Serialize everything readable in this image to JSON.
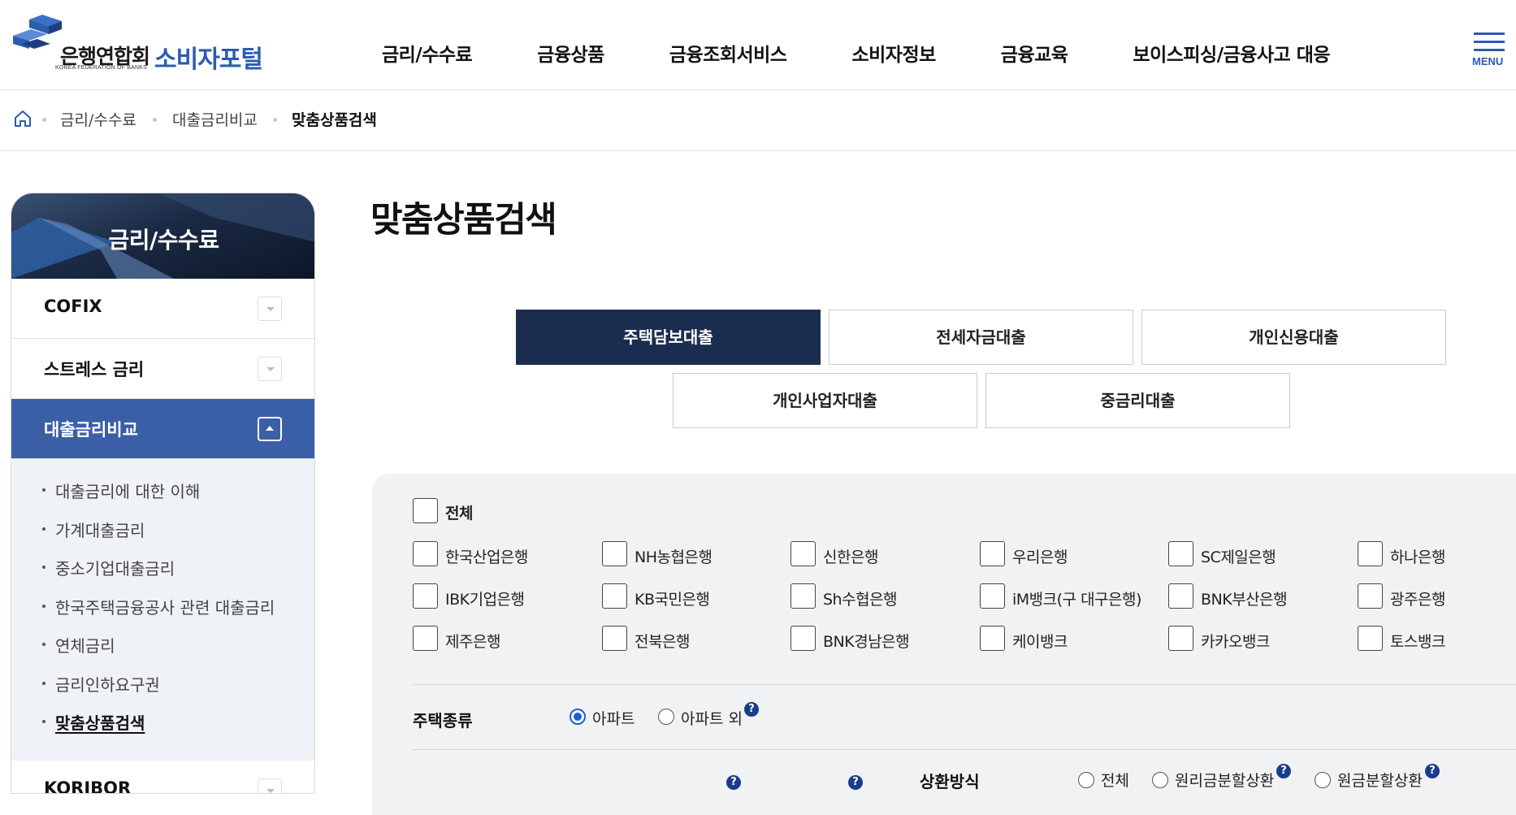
{
  "header": {
    "logo": {
      "org_kor": "은행연합회",
      "org_eng": "KOREA FEDERATION OF BANKS",
      "portal": "소비자포털"
    },
    "nav": [
      "금리/수수료",
      "금융상품",
      "금융조회서비스",
      "소비자정보",
      "금융교육",
      "보이스피싱/금융사고 대응"
    ],
    "menu_label": "MENU"
  },
  "breadcrumb": [
    "금리/수수료",
    "대출금리비교",
    "맞춤상품검색"
  ],
  "sidebar": {
    "title": "금리/수수료",
    "menus": [
      "COFIX",
      "스트레스 금리",
      "대출금리비교",
      "KORIBOR"
    ],
    "submenu": [
      "대출금리에 대한 이해",
      "가계대출금리",
      "중소기업대출금리",
      "한국주택금융공사 관련 대출금리",
      "연체금리",
      "금리인하요구권",
      "맞춤상품검색"
    ]
  },
  "main": {
    "title": "맞춤상품검색",
    "tabs": [
      "주택담보대출",
      "전세자금대출",
      "개인신용대출",
      "개인사업자대출",
      "중금리대출"
    ],
    "all_label": "전체",
    "banks": [
      "한국산업은행",
      "NH농협은행",
      "신한은행",
      "우리은행",
      "SC제일은행",
      "하나은행",
      "IBK기업은행",
      "KB국민은행",
      "Sh수협은행",
      "iM뱅크(구 대구은행)",
      "BNK부산은행",
      "광주은행",
      "제주은행",
      "전북은행",
      "BNK경남은행",
      "케이뱅크",
      "카카오뱅크",
      "토스뱅크"
    ],
    "house_type": {
      "label": "주택종류",
      "options": [
        "아파트",
        "아파트 외"
      ],
      "selected": "아파트"
    },
    "repay": {
      "label": "상환방식",
      "options": [
        "전체",
        "원리금분할상환",
        "원금분할상환"
      ]
    },
    "help_glyph": "?"
  },
  "colors": {
    "brand_blue": "#2a5db0",
    "navy": "#1b2d4f",
    "side_active": "#3b5fa6",
    "radio": "#1d5fd0"
  }
}
